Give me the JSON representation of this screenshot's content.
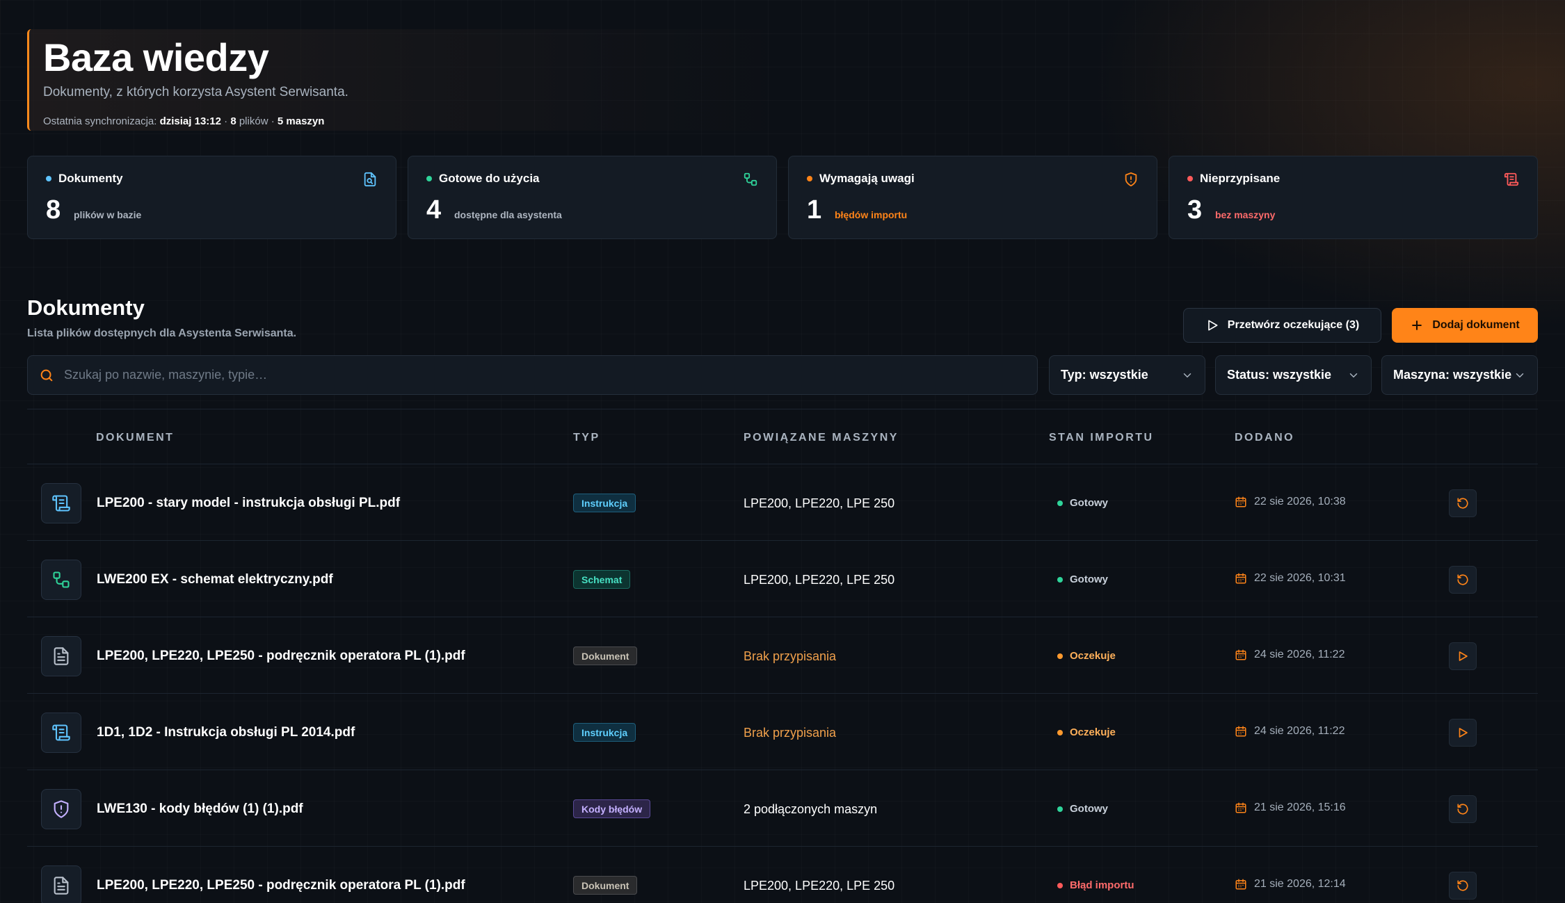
{
  "header": {
    "title": "Baza wiedzy",
    "subtitle": "Dokumenty, z których korzysta Asystent Serwisanta.",
    "sync_label": "Ostatnia synchronizacja:",
    "sync_time": "dzisiaj 13:12",
    "sep1": "·",
    "file_count": "8",
    "file_unit": "plików",
    "sep2": "·",
    "machine_count": "5 maszyn"
  },
  "stats": [
    {
      "label": "Dokumenty",
      "value": "8",
      "desc": "plików w bazie",
      "dot_color": "#5fc4ff",
      "icon": "file-search-icon",
      "icon_color": "#5fc4ff",
      "desc_color": "#aeb6c1"
    },
    {
      "label": "Gotowe do użycia",
      "value": "4",
      "desc": "dostępne dla asystenta",
      "dot_color": "#2fd49a",
      "icon": "workflow-icon",
      "icon_color": "#2fd49a",
      "desc_color": "#aeb6c1"
    },
    {
      "label": "Wymagają uwagi",
      "value": "1",
      "desc": "błędów importu",
      "dot_color": "#ff8418",
      "icon": "shield-alert-icon",
      "icon_color": "#ff8418",
      "desc_color": "#ff8418"
    },
    {
      "label": "Nieprzypisane",
      "value": "3",
      "desc": "bez maszyny",
      "dot_color": "#ff5a5a",
      "icon": "scroll-icon",
      "icon_color": "#ff5a5a",
      "desc_color": "#ff6b6b"
    }
  ],
  "documents_section": {
    "title": "Dokumenty",
    "subtitle": "Lista plików dostępnych dla Asystenta Serwisanta.",
    "process_button": "Przetwórz oczekujące (3)",
    "add_button": "Dodaj dokument"
  },
  "search": {
    "placeholder": "Szukaj po nazwie, maszynie, typie…",
    "value": ""
  },
  "filters": [
    {
      "label": "Typ: wszystkie"
    },
    {
      "label": "Status: wszystkie"
    },
    {
      "label": "Maszyna: wszystkie"
    }
  ],
  "table": {
    "headers": {
      "document": "DOKUMENT",
      "type": "TYP",
      "machines": "POWIĄZANE MASZYNY",
      "status": "STAN IMPORTU",
      "added": "DODANO"
    },
    "rows": [
      {
        "name": "LPE200 - stary model - instrukcja obsługi PL.pdf",
        "type": "Instrukcja",
        "machines": "LPE200, LPE220, LPE 250",
        "status": "Gotowy",
        "date": "22 sie 2026, 10:38",
        "icon": "scroll-icon",
        "action": "reprocess-icon"
      },
      {
        "name": "LWE200 EX - schemat elektryczny.pdf",
        "type": "Schemat",
        "machines": "LPE200, LPE220, LPE 250",
        "status": "Gotowy",
        "date": "22 sie 2026, 10:31",
        "icon": "workflow-icon",
        "action": "reprocess-icon"
      },
      {
        "name": "LPE200, LPE220, LPE250 - podręcznik operatora PL (1).pdf",
        "type": "Dokument",
        "machines": "Brak przypisania",
        "status": "Oczekuje",
        "date": "24 sie 2026, 11:22",
        "icon": "file-text-icon",
        "action": "play-icon"
      },
      {
        "name": "1D1, 1D2 - Instrukcja obsługi PL 2014.pdf",
        "type": "Instrukcja",
        "machines": "Brak przypisania",
        "status": "Oczekuje",
        "date": "24 sie 2026, 11:22",
        "icon": "scroll-icon",
        "action": "play-icon"
      },
      {
        "name": "LWE130 - kody błędów (1) (1).pdf",
        "type": "Kody błędów",
        "machines": "2 podłączonych maszyn",
        "status": "Gotowy",
        "date": "21 sie 2026, 15:16",
        "icon": "shield-alert-icon",
        "action": "reprocess-icon"
      },
      {
        "name": "LPE200, LPE220, LPE250 - podręcznik operatora PL (1).pdf",
        "type": "Dokument",
        "machines": "LPE200, LPE220, LPE 250",
        "status": "Błąd importu",
        "date": "21 sie 2026, 12:14",
        "icon": "file-text-icon",
        "action": "reprocess-icon"
      }
    ]
  },
  "colors": {
    "accent": "#ff8418",
    "ready": "#2fd49a",
    "pending": "#ff9a2e",
    "error": "#ff5a5a",
    "unassigned": "#f0a04b"
  }
}
